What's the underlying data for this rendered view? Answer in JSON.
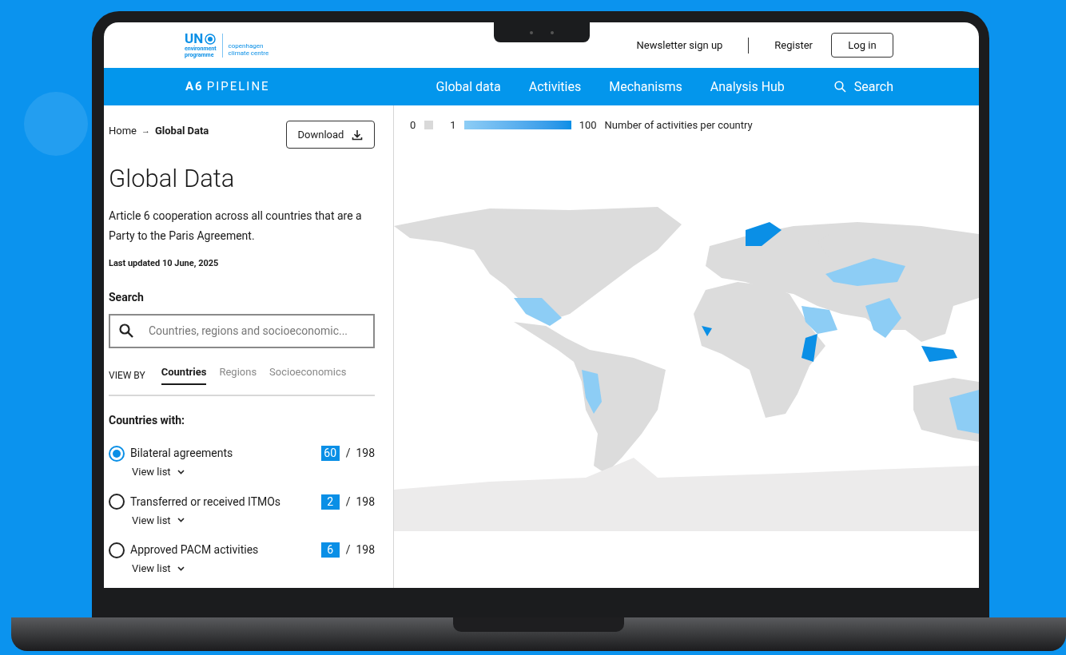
{
  "header": {
    "logo": {
      "mark": "UN",
      "name_lines": [
        "environment",
        "programme"
      ],
      "partner_lines": [
        "copenhagen",
        "climate centre"
      ]
    },
    "links": [
      "Newsletter sign up",
      "Register"
    ],
    "login_button": "Log in"
  },
  "nav": {
    "brand_bold": "A6",
    "brand": "PIPELINE",
    "items": [
      "Global data",
      "Activities",
      "Mechanisms",
      "Analysis Hub"
    ],
    "search": "Search"
  },
  "sidebar": {
    "breadcrumb": [
      "Home",
      "Global Data"
    ],
    "breadcrumb_separator": "→",
    "download_button": "Download",
    "title": "Global Data",
    "description": "Article 6 cooperation across all countries that are a Party to the Paris Agreement.",
    "last_updated": "Last updated 10 June, 2025",
    "search_label": "Search",
    "search": {
      "placeholder": "Countries, regions and socioeconomic..."
    },
    "view_by_label": "VIEW BY",
    "tabs": [
      {
        "label": "Countries",
        "selected": true
      },
      {
        "label": "Regions",
        "selected": false
      },
      {
        "label": "Socioeconomics",
        "selected": false
      }
    ],
    "filter_heading": "Countries with:",
    "options": [
      {
        "label": "Bilateral agreements",
        "selected": true,
        "count": "60",
        "total": "/  198",
        "link": "View list"
      },
      {
        "label": "Transferred or received ITMOs",
        "selected": false,
        "count": "2",
        "total": "/  198",
        "link": "View list"
      },
      {
        "label": "Approved PACM activities",
        "selected": false,
        "count": "6",
        "total": "/  198",
        "link": "View list"
      }
    ]
  },
  "legend": {
    "zero": "0",
    "min": "1",
    "max": "100",
    "caption": "Number of activities per country"
  }
}
